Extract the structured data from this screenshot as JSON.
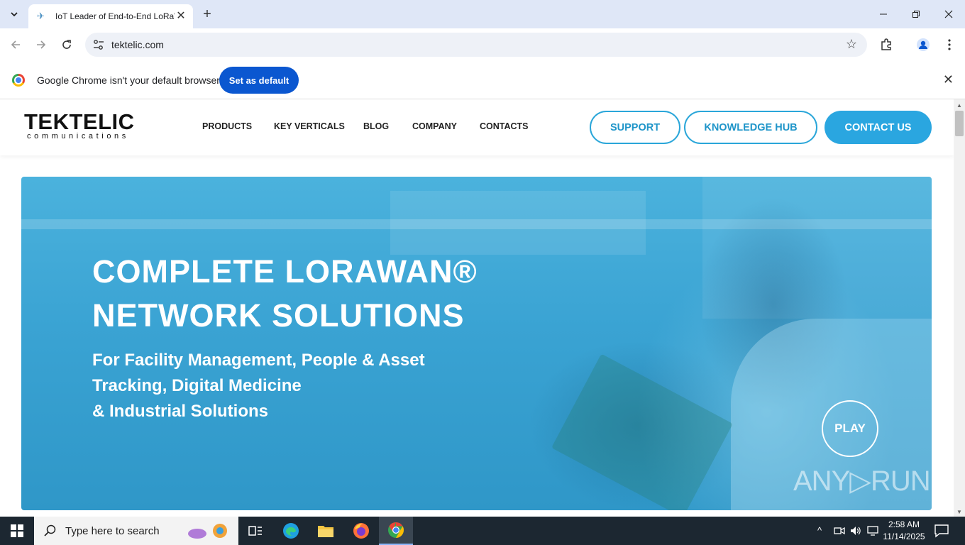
{
  "browser": {
    "tab_title": "IoT Leader of End-to-End LoRaWAN",
    "tab_close": "✕",
    "new_tab": "+",
    "url": "tektelic.com"
  },
  "infobar": {
    "message": "Google Chrome isn't your default browser",
    "button_label": "Set as default",
    "close": "✕"
  },
  "site": {
    "logo_main": "TEKTELIC",
    "logo_sub": "communications",
    "nav": [
      "PRODUCTS",
      "KEY VERTICALS",
      "BLOG",
      "COMPANY",
      "CONTACTS"
    ],
    "support_label": "SUPPORT",
    "knowledge_label": "KNOWLEDGE HUB",
    "contact_label": "CONTACT US"
  },
  "hero": {
    "title_line1": "COMPLETE LORAWAN®",
    "title_line2": "NETWORK SOLUTIONS",
    "subtitle_line1": "For Facility Management, People & Asset",
    "subtitle_line2": "Tracking, Digital Medicine",
    "subtitle_line3": "& Industrial Solutions",
    "play_label": "PLAY",
    "watermark": "ANY▷RUN"
  },
  "taskbar": {
    "search_placeholder": "Type here to search",
    "time": "2:58 AM",
    "date": "11/14/2025"
  },
  "colors": {
    "accent": "#2aa6e0",
    "chrome_blue": "#0b57d0",
    "taskbar": "#1c2731"
  }
}
